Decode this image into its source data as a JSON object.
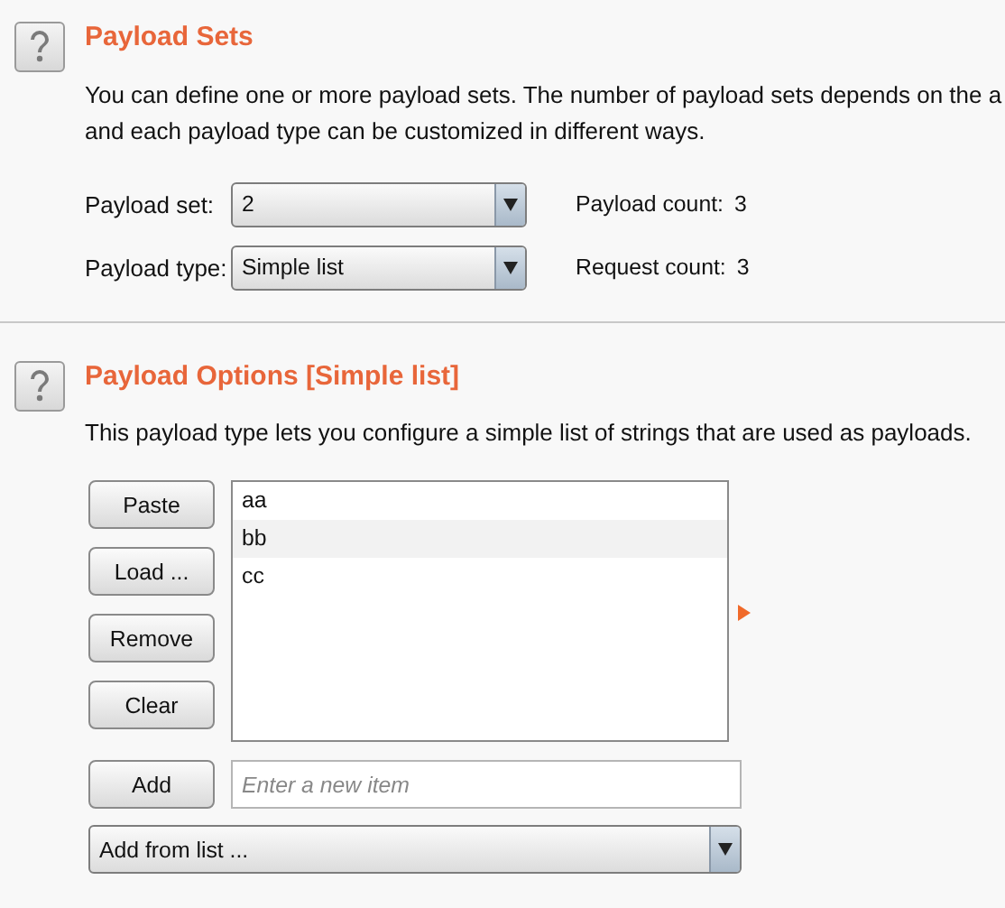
{
  "sections": [
    {
      "title": "Payload Sets",
      "description": [
        "You can define one or more payload sets. The number of payload sets depends on the a",
        "and each payload type can be customized in different ways."
      ]
    },
    {
      "title": "Payload Options [Simple list]",
      "description": [
        "This payload type lets you configure a simple list of strings that are used as payloads."
      ]
    }
  ],
  "settings": [
    {
      "label": "Payload set:",
      "value": "2",
      "info_label": "Payload count:",
      "info_value": "3"
    },
    {
      "label": "Payload type:",
      "value": "Simple list",
      "info_label": "Request count:",
      "info_value": "3"
    }
  ],
  "list_buttons": [
    "Paste",
    "Load ...",
    "Remove",
    "Clear"
  ],
  "list_items": [
    "aa",
    "bb",
    "cc"
  ],
  "add_button": "Add",
  "new_item": {
    "placeholder": "Enter a new item"
  },
  "add_from_list": "Add from list ..."
}
